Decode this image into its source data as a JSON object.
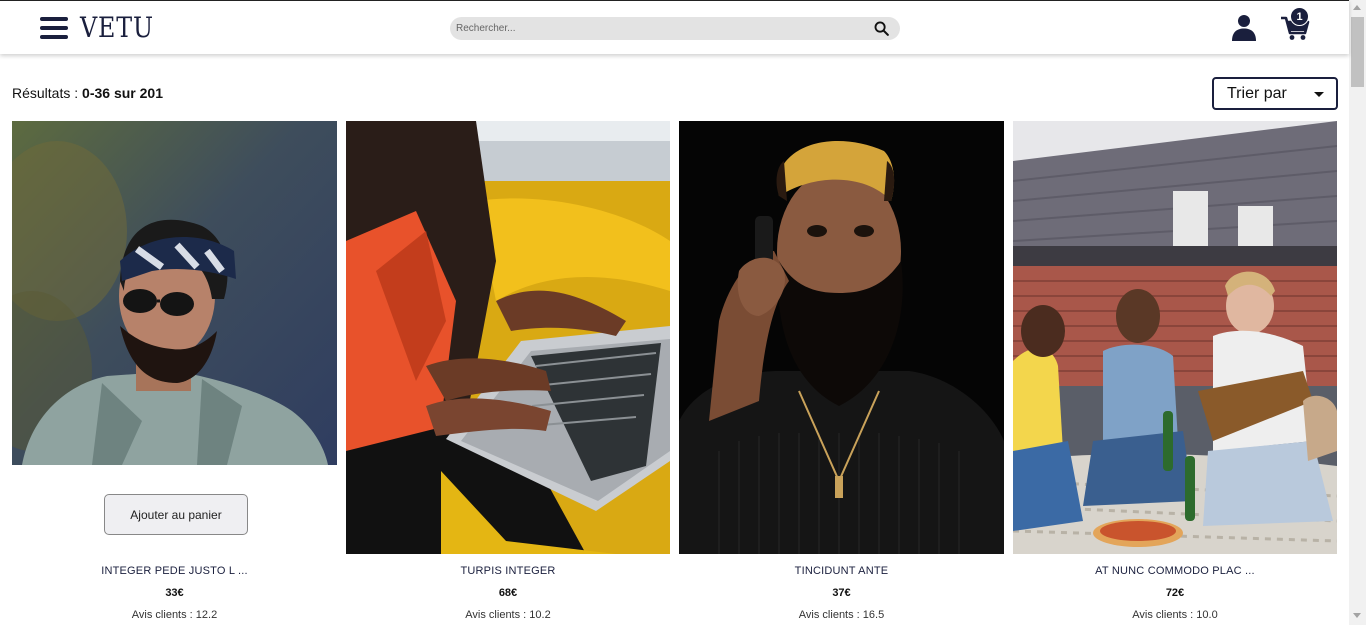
{
  "header": {
    "logo": "VETU",
    "search_placeholder": "Rechercher...",
    "cart_count": "1",
    "icons": [
      "menu-icon",
      "search-icon",
      "user-icon",
      "cart-icon"
    ]
  },
  "results": {
    "label": "Résultats : ",
    "range": "0-36 sur 201"
  },
  "sort": {
    "label": "Trier par"
  },
  "add_to_cart_label": "Ajouter au panier",
  "products": [
    {
      "name": "INTEGER PEDE JUSTO L ...",
      "price": "33€",
      "reviews": "Avis clients : 12.2"
    },
    {
      "name": "TURPIS INTEGER",
      "price": "68€",
      "reviews": "Avis clients : 10.2"
    },
    {
      "name": "TINCIDUNT ANTE",
      "price": "37€",
      "reviews": "Avis clients : 16.5"
    },
    {
      "name": "AT NUNC COMMODO PLAC ...",
      "price": "72€",
      "reviews": "Avis clients : 10.0"
    }
  ],
  "colors": {
    "brand": "#1a1f3d",
    "search_bg": "#e3e3e3",
    "button_bg": "#efeff2"
  }
}
